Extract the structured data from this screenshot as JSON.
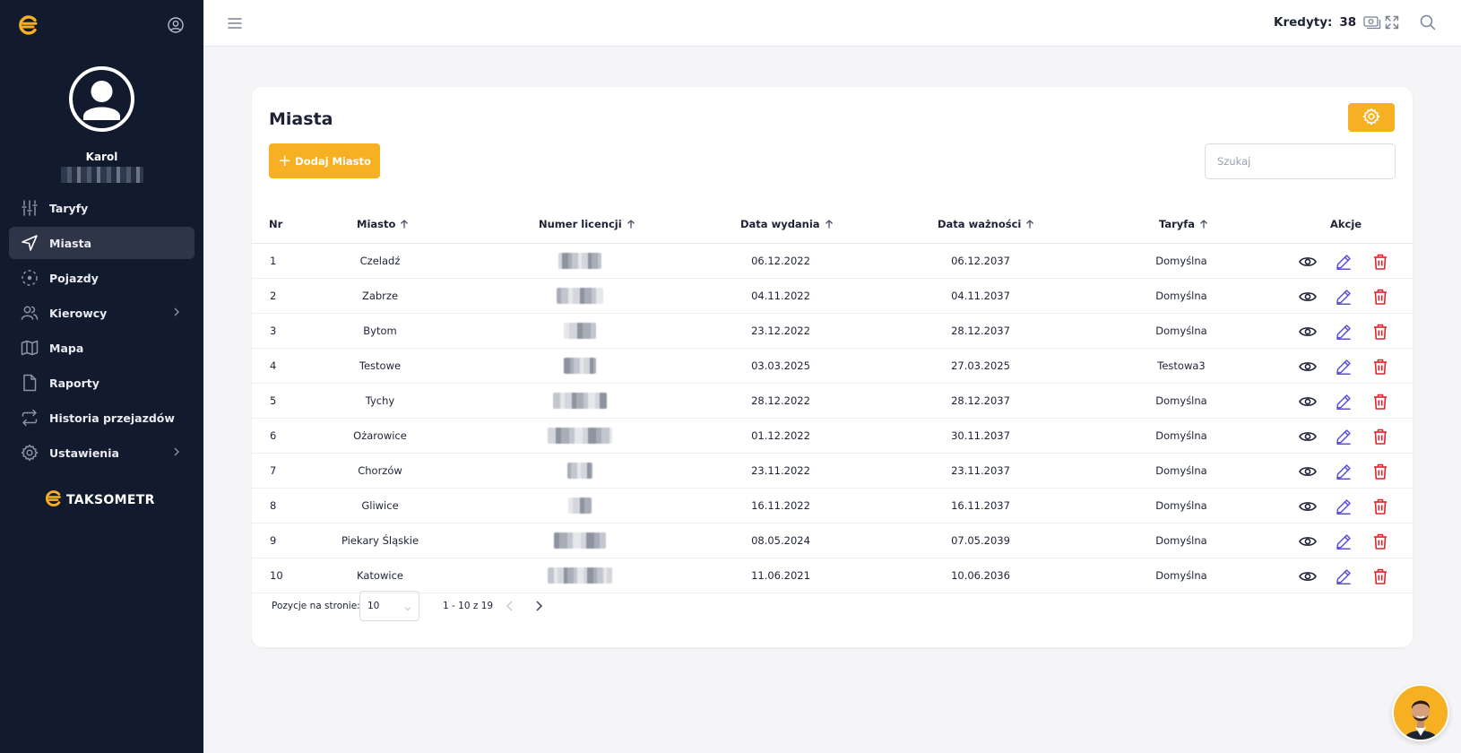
{
  "sidebar": {
    "user": {
      "name": "Karol"
    },
    "menu": [
      {
        "label": "Taryfy",
        "icon": "sliders-icon"
      },
      {
        "label": "Miasta",
        "icon": "navigation-arrow-icon",
        "active": true
      },
      {
        "label": "Pojazdy",
        "icon": "dashed-circle-icon"
      },
      {
        "label": "Kierowcy",
        "icon": "users-icon",
        "has_submenu": true
      },
      {
        "label": "Mapa",
        "icon": "map-icon"
      },
      {
        "label": "Raporty",
        "icon": "file-icon"
      },
      {
        "label": "Historia przejazdów",
        "icon": "repeat-icon"
      },
      {
        "label": "Ustawienia",
        "icon": "gear-icon",
        "has_submenu": true
      }
    ],
    "brand": "TAKSOMETR"
  },
  "topbar": {
    "credits_label": "Kredyty:",
    "credits_value": "38"
  },
  "main": {
    "title": "Miasta",
    "add_button": "Dodaj Miasto",
    "search_placeholder": "Szukaj",
    "columns": [
      "Nr",
      "Miasto",
      "Numer licencji",
      "Data wydania",
      "Data ważności",
      "Taryfa",
      "Akcje"
    ],
    "rows": [
      {
        "nr": "1",
        "miasto": "Czeladź",
        "wydania": "06.12.2022",
        "waznosci": "06.12.2037",
        "taryfa": "Domyślna"
      },
      {
        "nr": "2",
        "miasto": "Zabrze",
        "wydania": "04.11.2022",
        "waznosci": "04.11.2037",
        "taryfa": "Domyślna"
      },
      {
        "nr": "3",
        "miasto": "Bytom",
        "wydania": "23.12.2022",
        "waznosci": "28.12.2037",
        "taryfa": "Domyślna"
      },
      {
        "nr": "4",
        "miasto": "Testowe",
        "wydania": "03.03.2025",
        "waznosci": "27.03.2025",
        "taryfa": "Testowa3"
      },
      {
        "nr": "5",
        "miasto": "Tychy",
        "wydania": "28.12.2022",
        "waznosci": "28.12.2037",
        "taryfa": "Domyślna"
      },
      {
        "nr": "6",
        "miasto": "Ożarowice",
        "wydania": "01.12.2022",
        "waznosci": "30.11.2037",
        "taryfa": "Domyślna"
      },
      {
        "nr": "7",
        "miasto": "Chorzów",
        "wydania": "23.11.2022",
        "waznosci": "23.11.2037",
        "taryfa": "Domyślna"
      },
      {
        "nr": "8",
        "miasto": "Gliwice",
        "wydania": "16.11.2022",
        "waznosci": "16.11.2037",
        "taryfa": "Domyślna"
      },
      {
        "nr": "9",
        "miasto": "Piekary Śląskie",
        "wydania": "08.05.2024",
        "waznosci": "07.05.2039",
        "taryfa": "Domyślna"
      },
      {
        "nr": "10",
        "miasto": "Katowice",
        "wydania": "11.06.2021",
        "waznosci": "10.06.2036",
        "taryfa": "Domyślna"
      }
    ],
    "pagination": {
      "label": "Pozycje na stronie:",
      "per_page": "10",
      "range": "1 - 10 z 19"
    }
  },
  "colors": {
    "sidebar_bg": "#121a2e",
    "accent": "#f6b021",
    "edit_icon": "#5b4fd8",
    "delete_icon": "#e0222a"
  }
}
